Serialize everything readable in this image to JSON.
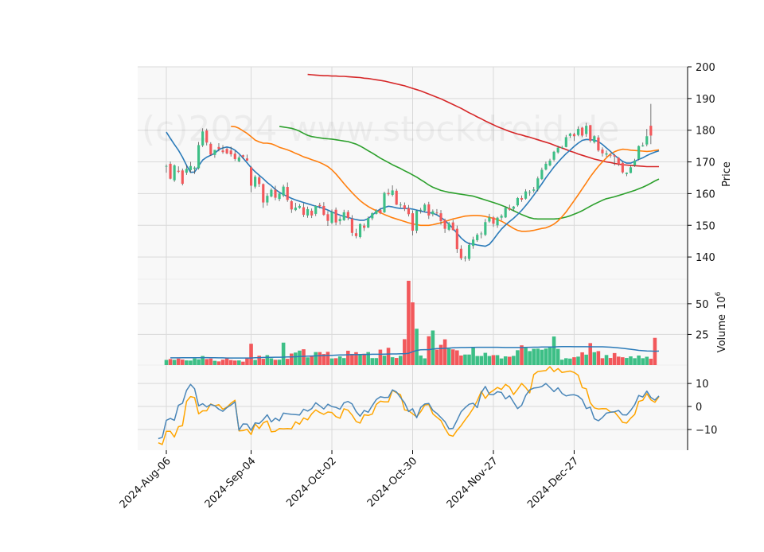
{
  "chart_data": {
    "type": "candlestick",
    "watermark": "(c)2024 www.stockdroid.de",
    "colors": {
      "up": "#3dbf86",
      "down": "#f2585b",
      "sma20": "#2b7bb9",
      "sma50": "#ff7f0e",
      "sma100": "#2ca02c",
      "sma200": "#d62728",
      "osc_fast": "#4a86b8",
      "osc_slow": "#ffa500",
      "volume_ma": "#2b7bb9"
    },
    "x_tick_labels": [
      "2024-Aug-06",
      "2024-Sep-04",
      "2024-Oct-02",
      "2024-Oct-30",
      "2024-Nov-27",
      "2024-Dec-27"
    ],
    "x_tick_index": [
      0,
      21,
      41,
      61,
      81,
      101
    ],
    "price_panel": {
      "ylabel": "Price",
      "ylim": [
        133,
        200
      ],
      "yticks": [
        140,
        150,
        160,
        170,
        180,
        190,
        200
      ]
    },
    "volume_panel": {
      "ylabel": "Volume  10^6",
      "ylabel_main": "Volume",
      "ylabel_exp_base": "10",
      "ylabel_exp": "6",
      "ylim": [
        0,
        70
      ],
      "yticks": [
        25,
        50
      ]
    },
    "oscillator_panel": {
      "ylim": [
        -19,
        18
      ],
      "yticks": [
        -10,
        0,
        10
      ],
      "ytick_labels": [
        "−10",
        "0",
        "10"
      ]
    },
    "closes": [
      168.7,
      164.7,
      168.9,
      166.9,
      163.1,
      167.8,
      168.7,
      168.2,
      175.3,
      179.6,
      176.1,
      172.3,
      173.8,
      174.1,
      173.1,
      172.7,
      172.4,
      170.9,
      171.4,
      171.6,
      170.4,
      162.5,
      165.3,
      163.0,
      157.2,
      159.3,
      161.2,
      158.7,
      160.0,
      162.2,
      158.0,
      155.0,
      155.6,
      156.1,
      153.3,
      155.1,
      153.1,
      156.1,
      156.0,
      153.3,
      151.4,
      154.2,
      150.9,
      152.0,
      154.1,
      152.3,
      147.6,
      146.6,
      150.4,
      149.2,
      152.3,
      153.8,
      154.7,
      153.8,
      160.2,
      159.8,
      161.0,
      156.5,
      156.5,
      155.2,
      153.5,
      148.3,
      154.6,
      154.9,
      156.5,
      153.1,
      154.4,
      153.9,
      151.3,
      148.9,
      150.6,
      148.5,
      142.5,
      139.6,
      139.8,
      143.8,
      145.5,
      147.0,
      147.4,
      151.0,
      152.5,
      150.5,
      152.4,
      153.0,
      155.5,
      154.9,
      155.9,
      158.6,
      158.1,
      160.7,
      160.6,
      161.3,
      164.8,
      167.5,
      169.4,
      170.4,
      173.2,
      174.5,
      174.6,
      177.8,
      178.9,
      178.1,
      180.4,
      178.3,
      181.4,
      176.7,
      178.1,
      173.6,
      172.7,
      172.7,
      172.1,
      171.7,
      169.3,
      166.7,
      166.6,
      168.3,
      170.4,
      175.0,
      175.2,
      178.1,
      178.3,
      176.3,
      177.8
    ],
    "opens": [
      168.7,
      169.4,
      164.2,
      167.2,
      167.3,
      166.6,
      167.4,
      167.8,
      168.0,
      175.2,
      179.9,
      175.7,
      172.2,
      174.7,
      173.6,
      174.1,
      173.6,
      172.6,
      170.2,
      172.1,
      171.1,
      168.3,
      162.2,
      165.1,
      163.0,
      157.2,
      159.1,
      161.2,
      158.3,
      159.4,
      162.1,
      157.6,
      154.8,
      155.5,
      155.7,
      153.1,
      154.6,
      153.6,
      156.4,
      156.1,
      153.5,
      150.8,
      154.9,
      151.3,
      151.6,
      154.2,
      152.1,
      147.5,
      146.3,
      149.9,
      149.3,
      152.2,
      153.6,
      154.8,
      154.1,
      160.2,
      159.6,
      160.9,
      156.4,
      156.3,
      155.4,
      153.8,
      148.3,
      154.7,
      154.6,
      156.6,
      153.5,
      154.0,
      153.8,
      151.7,
      148.6,
      150.9,
      148.9,
      142.6,
      139.6,
      139.4,
      143.5,
      145.3,
      147.4,
      147.0,
      151.2,
      152.5,
      150.0,
      152.4,
      152.5,
      155.4,
      155.2,
      156.3,
      158.6,
      158.4,
      160.5,
      160.9,
      161.3,
      164.6,
      167.6,
      168.9,
      170.7,
      173.0,
      174.6,
      174.7,
      178.2,
      178.8,
      178.5,
      180.8,
      178.8,
      181.6,
      176.2,
      177.7,
      173.9,
      172.3,
      172.2,
      172.1,
      171.3,
      169.7,
      166.2,
      166.5,
      168.9,
      170.9,
      174.9,
      175.5,
      181.4
    ],
    "highs": [
      169.2,
      170.1,
      169.2,
      168.6,
      167.9,
      169.0,
      170.0,
      168.6,
      176.3,
      180.6,
      180.5,
      176.2,
      173.3,
      175.9,
      175.3,
      174.5,
      174.8,
      173.5,
      172.0,
      172.3,
      172.3,
      168.7,
      165.8,
      165.6,
      163.2,
      160.1,
      161.7,
      162.5,
      160.2,
      162.8,
      163.5,
      158.0,
      157.1,
      156.7,
      157.0,
      155.9,
      155.3,
      156.3,
      157.1,
      157.3,
      154.5,
      155.0,
      155.6,
      152.8,
      154.9,
      154.8,
      153.2,
      148.9,
      150.6,
      150.6,
      152.8,
      154.1,
      155.1,
      155.5,
      160.6,
      161.5,
      162.6,
      161.5,
      157.3,
      157.2,
      156.4,
      154.7,
      154.8,
      155.5,
      157.0,
      157.4,
      155.0,
      155.1,
      154.8,
      152.1,
      151.1,
      151.7,
      149.9,
      143.7,
      140.3,
      144.6,
      146.4,
      147.5,
      148.0,
      152.0,
      153.6,
      152.9,
      152.7,
      153.5,
      156.0,
      156.5,
      156.1,
      158.9,
      159.4,
      161.4,
      161.1,
      162.1,
      165.4,
      168.2,
      170.1,
      171.0,
      173.5,
      175.1,
      175.1,
      178.5,
      179.2,
      179.2,
      181.2,
      181.1,
      182.3,
      181.6,
      178.4,
      178.4,
      174.6,
      173.6,
      172.5,
      172.5,
      171.5,
      170.1,
      166.7,
      168.9,
      171.0,
      175.2,
      176.1,
      180.4,
      188.3
    ],
    "lows": [
      166.6,
      164.5,
      163.7,
      166.5,
      162.6,
      165.9,
      166.5,
      166.2,
      167.6,
      174.7,
      175.2,
      171.9,
      171.3,
      173.3,
      172.6,
      172.4,
      171.7,
      170.3,
      169.9,
      170.9,
      170.3,
      160.4,
      161.6,
      162.1,
      155.5,
      156.2,
      158.8,
      157.9,
      157.6,
      158.9,
      157.4,
      153.9,
      154.5,
      155.2,
      152.6,
      152.4,
      152.3,
      152.9,
      155.3,
      153.0,
      149.8,
      150.3,
      150.0,
      150.2,
      151.4,
      151.6,
      146.6,
      145.9,
      145.9,
      148.2,
      149.1,
      151.6,
      153.4,
      153.5,
      153.9,
      159.3,
      159.1,
      156.4,
      155.6,
      154.5,
      152.8,
      146.8,
      147.5,
      153.7,
      154.1,
      152.0,
      152.8,
      153.2,
      150.2,
      147.6,
      148.2,
      148.3,
      141.3,
      139.0,
      138.6,
      138.8,
      142.6,
      144.8,
      145.9,
      146.6,
      150.8,
      149.5,
      149.2,
      151.6,
      152.3,
      154.6,
      154.4,
      155.9,
      157.4,
      158.1,
      159.3,
      160.3,
      160.7,
      164.3,
      167.3,
      168.6,
      170.2,
      172.6,
      174.1,
      174.6,
      177.6,
      176.6,
      178.1,
      177.8,
      177.9,
      176.1,
      175.8,
      173.2,
      171.7,
      171.6,
      171.3,
      168.9,
      168.7,
      166.3,
      165.5,
      166.4,
      168.4,
      170.5,
      174.8,
      174.9,
      175.6
    ],
    "volumes": [
      4.2,
      4.9,
      4.3,
      5.3,
      4.5,
      3.8,
      3.7,
      5.4,
      4.7,
      7.4,
      4.9,
      5.3,
      3.5,
      3.0,
      4.4,
      5.9,
      4.1,
      3.7,
      3.8,
      2.8,
      5.5,
      17.4,
      4.2,
      7.6,
      5.1,
      8.1,
      5.5,
      4.3,
      4.4,
      18.3,
      5.1,
      9.4,
      10.2,
      11.8,
      12.9,
      6.3,
      7.8,
      10.6,
      10.6,
      9.0,
      10.8,
      5.4,
      5.6,
      7.1,
      5.7,
      11.7,
      9.1,
      10.5,
      8.3,
      9.2,
      10.6,
      5.7,
      5.7,
      12.6,
      7.7,
      14.1,
      6.4,
      5.8,
      7.5,
      21.1,
      68.7,
      51.1,
      29.6,
      7.8,
      5.5,
      23.5,
      28.2,
      12.6,
      16.5,
      21.0,
      13.3,
      12.8,
      12.0,
      7.8,
      8.6,
      8.6,
      14.1,
      7.4,
      7.4,
      10.0,
      7.4,
      8.1,
      8.1,
      5.4,
      7.1,
      6.8,
      7.5,
      12.1,
      16.1,
      13.9,
      11.4,
      13.3,
      13.4,
      12.5,
      13.5,
      14.3,
      23.3,
      13.2,
      4.4,
      5.6,
      5.3,
      6.4,
      6.9,
      10.4,
      8.5,
      17.9,
      10.5,
      11.4,
      5.6,
      8.2,
      5.8,
      9.8,
      6.9,
      6.4,
      5.8,
      7.1,
      5.6,
      7.8,
      5.6,
      6.8,
      5.2,
      22.2
    ],
    "volume_ma": [
      5.9,
      5.9,
      5.9,
      6.0,
      6.0,
      6.0,
      6.0,
      6.0,
      6.1,
      6.1,
      6.0,
      6.0,
      5.9,
      5.9,
      5.8,
      5.8,
      5.8,
      5.8,
      5.8,
      5.8,
      5.8,
      6.0,
      6.1,
      6.2,
      6.2,
      6.3,
      6.4,
      6.4,
      6.5,
      6.6,
      6.7,
      6.8,
      7.0,
      7.1,
      7.3,
      7.4,
      7.5,
      7.6,
      7.8,
      7.9,
      8.0,
      8.1,
      8.2,
      8.3,
      8.4,
      8.5,
      8.5,
      8.6,
      8.7,
      8.7,
      8.8,
      8.8,
      8.8,
      8.9,
      9.0,
      9.1,
      9.1,
      9.2,
      9.3,
      9.6,
      10.9,
      11.9,
      12.5,
      12.6,
      12.6,
      13.0,
      13.4,
      13.5,
      13.7,
      13.9,
      14.1,
      14.2,
      14.3,
      14.3,
      14.4,
      14.4,
      14.5,
      14.5,
      14.5,
      14.5,
      14.5,
      14.5,
      14.4,
      14.3,
      14.3,
      14.3,
      14.3,
      14.3,
      14.4,
      14.5,
      14.6,
      14.6,
      14.7,
      14.7,
      14.8,
      14.8,
      15.0,
      15.1,
      15.1,
      15.1,
      15.0,
      15.0,
      15.0,
      15.0,
      14.9,
      14.9,
      14.9,
      14.9,
      14.8,
      14.6,
      14.3,
      14.0,
      13.7,
      13.3,
      12.9,
      12.5,
      12.0,
      11.7,
      11.5,
      11.4,
      11.3,
      11.4
    ],
    "sma20": [
      179.4,
      177.4,
      175.5,
      173.7,
      171.5,
      168.9,
      166.7,
      166.8,
      168.7,
      170.6,
      171.5,
      172.1,
      172.7,
      173.9,
      174.4,
      174.7,
      174.4,
      173.7,
      172.6,
      171.2,
      169.7,
      168.2,
      166.9,
      165.8,
      164.7,
      163.5,
      162.5,
      161.3,
      160.4,
      159.7,
      159.1,
      158.5,
      158.0,
      157.6,
      157.2,
      156.8,
      156.4,
      156.0,
      155.7,
      155.3,
      154.8,
      154.2,
      153.7,
      153.2,
      152.8,
      152.5,
      152.1,
      151.8,
      151.6,
      151.6,
      152.1,
      153.2,
      154.3,
      155.1,
      155.6,
      156.0,
      155.8,
      155.5,
      155.3,
      155.3,
      155.3,
      155.1,
      154.8,
      154.5,
      154.2,
      154.0,
      153.8,
      153.3,
      152.5,
      151.5,
      150.3,
      149.0,
      147.5,
      146.0,
      144.9,
      144.2,
      144.1,
      143.8,
      143.6,
      143.4,
      144.0,
      145.5,
      147.2,
      148.8,
      150.1,
      151.2,
      152.2,
      153.4,
      154.7,
      156.2,
      157.8,
      159.5,
      161.3,
      163.1,
      165.0,
      166.7,
      168.4,
      169.9,
      171.3,
      172.6,
      173.7,
      174.9,
      175.9,
      176.8,
      177.1,
      177.0,
      176.9,
      176.4,
      175.5,
      174.4,
      173.3,
      172.1,
      171.1,
      170.2,
      169.6,
      169.6,
      170.2,
      170.8,
      171.3,
      172.0,
      172.6,
      173.1,
      173.5
    ],
    "sma50": [
      181.2,
      181.1,
      180.6,
      179.8,
      179.0,
      178.0,
      176.9,
      176.3,
      175.9,
      175.9,
      175.7,
      175.2,
      174.6,
      174.2,
      173.8,
      173.3,
      172.7,
      172.2,
      171.6,
      171.2,
      170.7,
      170.3,
      169.8,
      169.2,
      168.5,
      167.5,
      166.2,
      164.7,
      163.2,
      161.7,
      160.3,
      159.0,
      157.8,
      156.8,
      155.9,
      155.2,
      154.6,
      154.0,
      153.4,
      152.9,
      152.4,
      152.0,
      151.6,
      151.2,
      150.8,
      150.5,
      150.2,
      150.0,
      150.0,
      150.0,
      150.2,
      150.5,
      150.8,
      151.2,
      151.6,
      152.0,
      152.3,
      152.6,
      152.9,
      153.0,
      153.1,
      153.1,
      153.0,
      152.8,
      152.5,
      152.2,
      151.8,
      151.3,
      150.6,
      149.8,
      149.0,
      148.4,
      148.1,
      148.1,
      148.2,
      148.4,
      148.7,
      149.0,
      149.2,
      149.7,
      150.4,
      151.4,
      152.7,
      154.2,
      156.0,
      157.8,
      159.6,
      161.5,
      163.4,
      165.3,
      167.0,
      168.6,
      170.0,
      171.3,
      172.5,
      173.2,
      173.7,
      174.0,
      173.9,
      173.7,
      173.6,
      173.5,
      173.4,
      173.3,
      173.4,
      173.6,
      173.8
    ],
    "sma100": [
      181.2,
      181.0,
      180.8,
      180.6,
      180.2,
      179.7,
      179.0,
      178.4,
      178.0,
      177.8,
      177.6,
      177.4,
      177.3,
      177.2,
      177.0,
      176.8,
      176.6,
      176.4,
      176.0,
      175.6,
      175.0,
      174.3,
      173.5,
      172.8,
      172.0,
      171.2,
      170.5,
      169.8,
      169.1,
      168.5,
      167.9,
      167.2,
      166.6,
      165.9,
      165.2,
      164.4,
      163.6,
      162.7,
      162.0,
      161.5,
      161.0,
      160.7,
      160.4,
      160.2,
      160.0,
      159.8,
      159.6,
      159.4,
      159.2,
      158.8,
      158.4,
      158.0,
      157.6,
      157.2,
      156.8,
      156.3,
      155.8,
      155.2,
      154.6,
      154.0,
      153.4,
      152.9,
      152.4,
      152.1,
      152.0,
      152.0,
      152.0,
      152.0,
      152.0,
      152.1,
      152.3,
      152.6,
      153.0,
      153.5,
      154.0,
      154.6,
      155.3,
      156.0,
      156.7,
      157.3,
      157.9,
      158.4,
      158.7,
      159.0,
      159.4,
      159.8,
      160.2,
      160.6,
      161.0,
      161.5,
      162.0,
      162.6,
      163.3,
      164.0,
      164.6
    ],
    "sma200": [
      197.6,
      197.5,
      197.4,
      197.3,
      197.2,
      197.2,
      197.1,
      197.1,
      197.0,
      197.0,
      196.9,
      196.8,
      196.7,
      196.6,
      196.4,
      196.3,
      196.1,
      195.9,
      195.7,
      195.5,
      195.2,
      194.9,
      194.6,
      194.3,
      194.0,
      193.6,
      193.2,
      192.8,
      192.4,
      191.9,
      191.4,
      190.9,
      190.4,
      189.9,
      189.3,
      188.7,
      188.1,
      187.5,
      186.9,
      186.2,
      185.5,
      184.9,
      184.2,
      183.6,
      182.9,
      182.3,
      181.7,
      181.1,
      180.6,
      180.1,
      179.6,
      179.2,
      178.8,
      178.5,
      178.1,
      177.8,
      177.4,
      177.0,
      176.6,
      176.2,
      175.8,
      175.3,
      174.8,
      174.4,
      173.9,
      173.4,
      173.0,
      172.5,
      172.1,
      171.7,
      171.3,
      170.9,
      170.6,
      170.3,
      170.0,
      169.8,
      169.5,
      169.3,
      169.1,
      169.0,
      168.9,
      168.8,
      168.7,
      168.6,
      168.5,
      168.5,
      168.5,
      168.5
    ],
    "osc_fast": [
      -14.0,
      -13.4,
      -6.0,
      -5.2,
      -6.0,
      0.5,
      1.4,
      7.0,
      9.6,
      7.7,
      0.3,
      1.2,
      -0.2,
      0.9,
      0.3,
      -1.2,
      -2.1,
      -0.5,
      0.6,
      2.0,
      -10.3,
      -7.6,
      -7.7,
      -10.4,
      -7.1,
      -7.4,
      -5.7,
      -3.6,
      -6.7,
      -5.1,
      -6.2,
      -2.9,
      -3.2,
      -3.4,
      -3.5,
      -3.7,
      -1.2,
      -2.0,
      -0.9,
      1.6,
      0.3,
      -1.1,
      1.0,
      0.0,
      -0.4,
      -1.2,
      1.6,
      2.2,
      1.1,
      -2.2,
      -4.2,
      -1.7,
      -2.5,
      0.4,
      3.0,
      4.2,
      3.9,
      4.0,
      7.2,
      6.3,
      3.9,
      1.6,
      -2.2,
      -1.0,
      -4.9,
      -0.4,
      1.1,
      1.3,
      -1.7,
      -3.0,
      -4.8,
      -6.6,
      -9.7,
      -9.5,
      -6.0,
      -2.3,
      -0.5,
      1.0,
      1.4,
      -0.5,
      6.0,
      8.7,
      5.3,
      5.1,
      6.4,
      6.1,
      3.3,
      4.7,
      1.9,
      -0.9,
      0.5,
      4.8,
      7.2,
      8.0,
      8.2,
      8.7,
      10.0,
      8.3,
      6.5,
      8.1,
      5.7,
      4.6,
      5.0,
      5.1,
      4.5,
      3.0,
      -0.9,
      -0.3,
      -5.3,
      -6.2,
      -4.8,
      -2.9,
      -2.5,
      -2.3,
      -1.7,
      -3.6,
      -3.7,
      -1.7,
      0.8,
      4.8,
      4.1,
      6.7,
      3.9,
      2.8,
      4.6
    ],
    "osc_slow": [
      -15.8,
      -16.5,
      -10.8,
      -10.8,
      -13.3,
      -8.8,
      -8.3,
      2.2,
      4.3,
      3.9,
      -3.2,
      -1.9,
      -1.9,
      1.1,
      0.3,
      0.8,
      -1.2,
      -0.3,
      1.4,
      2.7,
      -10.6,
      -10.5,
      -9.9,
      -12.2,
      -7.6,
      -9.6,
      -7.1,
      -6.3,
      -11.0,
      -10.8,
      -9.6,
      -9.7,
      -9.6,
      -9.7,
      -6.7,
      -7.7,
      -5.0,
      -5.8,
      -3.2,
      -1.5,
      -2.6,
      -3.4,
      -2.4,
      -2.6,
      -4.4,
      -5.1,
      -1.0,
      -1.6,
      -3.7,
      -6.5,
      -7.2,
      -3.6,
      -3.9,
      -3.3,
      0.9,
      2.3,
      2.0,
      2.0,
      7.0,
      6.0,
      5.1,
      -1.5,
      -1.8,
      -3.2,
      -4.5,
      -2.3,
      0.6,
      0.9,
      -3.2,
      -4.7,
      -6.1,
      -9.5,
      -12.4,
      -12.9,
      -10.4,
      -8.3,
      -5.8,
      -3.5,
      -0.8,
      2.5,
      6.6,
      3.5,
      5.8,
      7.0,
      8.3,
      7.4,
      9.6,
      8.4,
      5.2,
      7.5,
      10.0,
      8.2,
      5.9,
      13.9,
      15.2,
      15.4,
      15.6,
      17.3,
      15.2,
      16.5,
      14.8,
      15.1,
      15.4,
      14.8,
      13.6,
      8.2,
      7.7,
      1.6,
      -0.6,
      -1.1,
      -0.9,
      -1.0,
      -2.4,
      -2.4,
      -4.5,
      -6.9,
      -7.2,
      -5.1,
      -3.4,
      2.2,
      2.7,
      5.6,
      2.9,
      1.8,
      4.3
    ]
  }
}
